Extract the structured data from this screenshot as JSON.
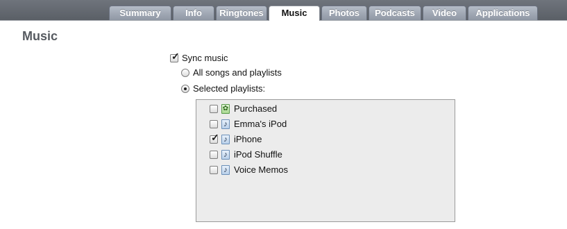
{
  "tabs": [
    {
      "label": "Summary",
      "active": false
    },
    {
      "label": "Info",
      "active": false
    },
    {
      "label": "Ringtones",
      "active": false
    },
    {
      "label": "Music",
      "active": true
    },
    {
      "label": "Photos",
      "active": false
    },
    {
      "label": "Podcasts",
      "active": false
    },
    {
      "label": "Video",
      "active": false
    },
    {
      "label": "Applications",
      "active": false
    }
  ],
  "page": {
    "title": "Music"
  },
  "sync": {
    "label": "Sync music",
    "checked": true
  },
  "options": {
    "all_label": "All songs and playlists",
    "all_selected": false,
    "selected_label": "Selected playlists:",
    "selected_selected": true
  },
  "playlists": [
    {
      "name": "Purchased",
      "checked": false,
      "icon": "purchased-playlist-icon"
    },
    {
      "name": "Emma's iPod",
      "checked": false,
      "icon": "music-note-playlist-icon"
    },
    {
      "name": "iPhone",
      "checked": true,
      "icon": "music-note-playlist-icon"
    },
    {
      "name": "iPod Shuffle",
      "checked": false,
      "icon": "music-note-playlist-icon"
    },
    {
      "name": "Voice Memos",
      "checked": false,
      "icon": "music-note-playlist-icon"
    }
  ],
  "colors": {
    "topbar": "#5e636a",
    "tab_inactive": "#9aa2ae",
    "tab_active": "#ffffff",
    "title": "#565a60",
    "list_background": "#ececec"
  }
}
